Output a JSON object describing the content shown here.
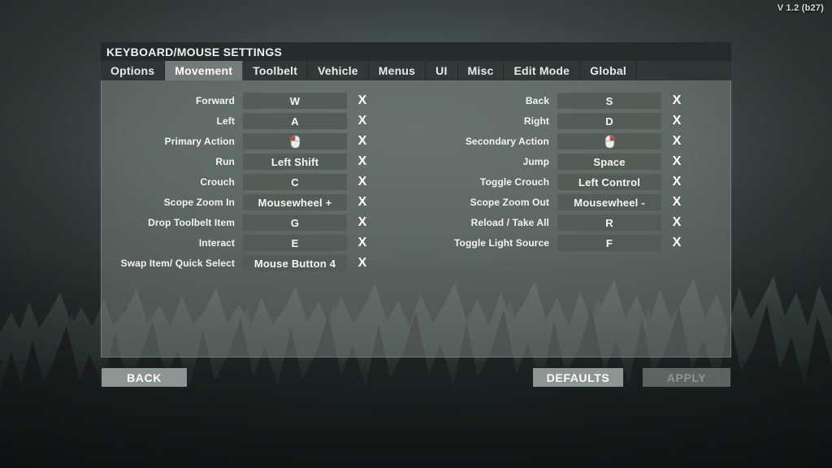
{
  "version": "V 1.2 (b27)",
  "panel": {
    "title": "KEYBOARD/MOUSE SETTINGS",
    "tabs": [
      {
        "label": "Options",
        "active": false
      },
      {
        "label": "Movement",
        "active": true
      },
      {
        "label": "Toolbelt",
        "active": false
      },
      {
        "label": "Vehicle",
        "active": false
      },
      {
        "label": "Menus",
        "active": false
      },
      {
        "label": "UI",
        "active": false
      },
      {
        "label": "Misc",
        "active": false
      },
      {
        "label": "Edit Mode",
        "active": false
      },
      {
        "label": "Global",
        "active": false
      }
    ],
    "clear_glyph": "X",
    "left_column": [
      {
        "label": "Forward",
        "value": "W",
        "icon": ""
      },
      {
        "label": "Left",
        "value": "A",
        "icon": ""
      },
      {
        "label": "Primary Action",
        "value": "",
        "icon": "mouse-left-button-icon"
      },
      {
        "label": "Run",
        "value": "Left Shift",
        "icon": ""
      },
      {
        "label": "Crouch",
        "value": "C",
        "icon": ""
      },
      {
        "label": "Scope Zoom In",
        "value": "Mousewheel +",
        "icon": ""
      },
      {
        "label": "Drop Toolbelt Item",
        "value": "G",
        "icon": ""
      },
      {
        "label": "Interact",
        "value": "E",
        "icon": ""
      },
      {
        "label": "Swap Item/ Quick Select",
        "value": "Mouse Button 4",
        "icon": ""
      }
    ],
    "right_column": [
      {
        "label": "Back",
        "value": "S",
        "icon": ""
      },
      {
        "label": "Right",
        "value": "D",
        "icon": ""
      },
      {
        "label": "Secondary Action",
        "value": "",
        "icon": "mouse-right-button-icon"
      },
      {
        "label": "Jump",
        "value": "Space",
        "icon": ""
      },
      {
        "label": "Toggle Crouch",
        "value": "Left Control",
        "icon": ""
      },
      {
        "label": "Scope Zoom Out",
        "value": "Mousewheel -",
        "icon": ""
      },
      {
        "label": "Reload / Take All",
        "value": "R",
        "icon": ""
      },
      {
        "label": "Toggle Light Source",
        "value": "F",
        "icon": ""
      }
    ]
  },
  "buttons": {
    "back": {
      "label": "BACK",
      "enabled": true
    },
    "defaults": {
      "label": "DEFAULTS",
      "enabled": true
    },
    "apply": {
      "label": "APPLY",
      "enabled": false
    }
  },
  "colors": {
    "highlight_red": "#d93b2b",
    "panel_body": "#87908c",
    "field": "#525a57",
    "text": "#f2f5f3"
  }
}
